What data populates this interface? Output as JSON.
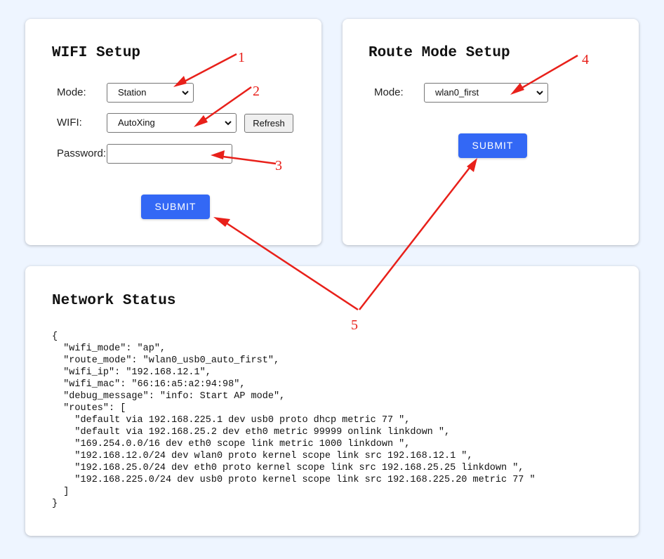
{
  "wifi_setup": {
    "title": "WIFI Setup",
    "mode_label": "Mode:",
    "mode_value": "Station",
    "wifi_label": "WIFI:",
    "wifi_value": "AutoXing",
    "refresh_label": "Refresh",
    "password_label": "Password:",
    "password_value": "",
    "submit_label": "SUBMIT"
  },
  "route_setup": {
    "title": "Route Mode Setup",
    "mode_label": "Mode:",
    "mode_value": "wlan0_first",
    "submit_label": "SUBMIT"
  },
  "network_status": {
    "title": "Network Status",
    "json_text": "{\n  \"wifi_mode\": \"ap\",\n  \"route_mode\": \"wlan0_usb0_auto_first\",\n  \"wifi_ip\": \"192.168.12.1\",\n  \"wifi_mac\": \"66:16:a5:a2:94:98\",\n  \"debug_message\": \"info: Start AP mode\",\n  \"routes\": [\n    \"default via 192.168.225.1 dev usb0 proto dhcp metric 77 \",\n    \"default via 192.168.25.2 dev eth0 metric 99999 onlink linkdown \",\n    \"169.254.0.0/16 dev eth0 scope link metric 1000 linkdown \",\n    \"192.168.12.0/24 dev wlan0 proto kernel scope link src 192.168.12.1 \",\n    \"192.168.25.0/24 dev eth0 proto kernel scope link src 192.168.25.25 linkdown \",\n    \"192.168.225.0/24 dev usb0 proto kernel scope link src 192.168.225.20 metric 77 \"\n  ]\n}"
  },
  "annotations": {
    "color": "#e8201a",
    "labels": [
      "1",
      "2",
      "3",
      "4",
      "5"
    ]
  },
  "colors": {
    "background": "#eef5ff",
    "primary_button": "#3368f5"
  }
}
